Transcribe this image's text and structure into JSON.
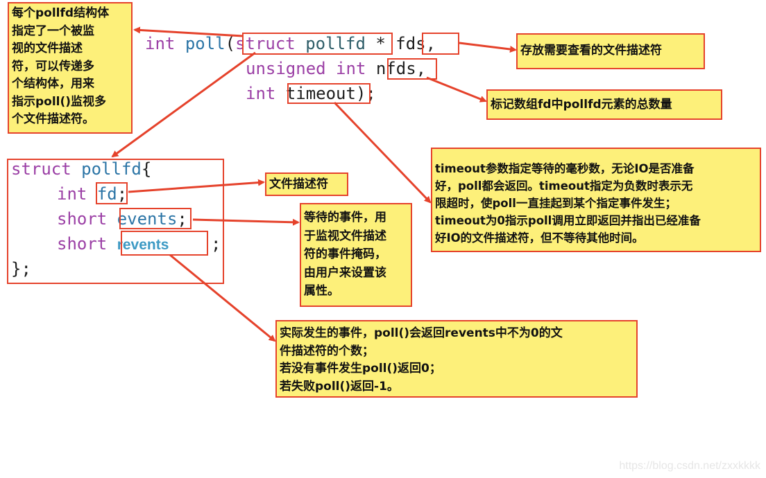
{
  "signature": {
    "ret_type": "int",
    "func_name": "poll",
    "open_paren": "(",
    "param1_kw": "struct",
    "param1_type": "pollfd",
    "param1_ptr": " * ",
    "param1_name": "fds",
    "comma": ",",
    "param2_kw1": "unsigned",
    "param2_kw2": "int",
    "param2_name": "nfds",
    "param3_kw": "int",
    "param3_name": "timeout",
    "close": ");"
  },
  "struct_def": {
    "kw": "struct",
    "name": "pollfd",
    "open_brace": "{",
    "fields": [
      {
        "type": "int",
        "name": "fd",
        "end": ";"
      },
      {
        "type": "short",
        "name": "events",
        "end": ";"
      },
      {
        "type": "short",
        "name": "revents",
        "end": ";"
      }
    ],
    "close": "};"
  },
  "notes": {
    "pollfd_struct": [
      "每个pollfd结构体",
      "指定了一个被监",
      "视的文件描述",
      "符，可以传递多",
      "个结构体，用来",
      "指示poll()监视多",
      "个文件描述符。"
    ],
    "fds": "存放需要查看的文件描述符",
    "nfds": "标记数组fd中pollfd元素的总数量",
    "timeout": [
      "timeout参数指定等待的毫秒数，无论IO是否准备",
      "好，poll都会返回。timeout指定为负数时表示无",
      "限超时，使poll一直挂起到某个指定事件发生；",
      "timeout为0指示poll调用立即返回并指出已经准备",
      "好IO的文件描述符，但不等待其他时间。"
    ],
    "fd": "文件描述符",
    "events": [
      "等待的事件，用",
      "于监视文件描述",
      "符的事件掩码，",
      "由用户来设置该",
      "属性。"
    ],
    "revents": [
      "实际发生的事件，poll()会返回revents中不为0的文",
      "件描述符的个数；",
      "若没有事件发生poll()返回0；",
      "若失败poll()返回-1。"
    ]
  },
  "colors": {
    "note_bg": "#fdf07a",
    "border": "#e5422b",
    "keyword": "#9b3fa5",
    "identifier": "#2c75a6"
  },
  "watermark": "https://blog.csdn.net/zxxkkkk"
}
